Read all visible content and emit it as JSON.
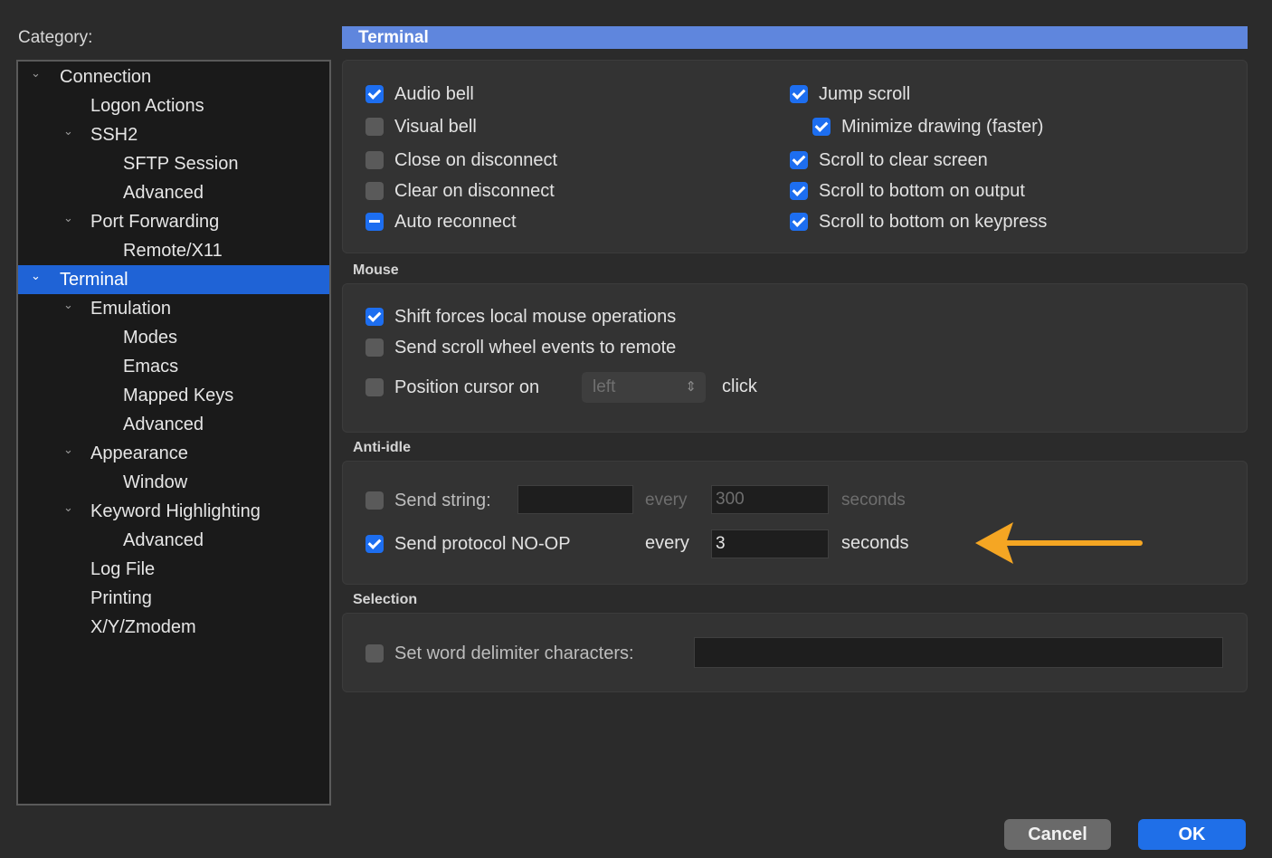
{
  "category_label": "Category:",
  "tree": [
    {
      "label": "Connection",
      "chevron": true,
      "level": 0
    },
    {
      "label": "Logon Actions",
      "chevron": false,
      "level": 1
    },
    {
      "label": "SSH2",
      "chevron": true,
      "level": 1
    },
    {
      "label": "SFTP Session",
      "chevron": false,
      "level": 2
    },
    {
      "label": "Advanced",
      "chevron": false,
      "level": 2
    },
    {
      "label": "Port Forwarding",
      "chevron": true,
      "level": 1
    },
    {
      "label": "Remote/X11",
      "chevron": false,
      "level": 2
    },
    {
      "label": "Terminal",
      "chevron": true,
      "level": 0,
      "selected": true
    },
    {
      "label": "Emulation",
      "chevron": true,
      "level": 1
    },
    {
      "label": "Modes",
      "chevron": false,
      "level": 2
    },
    {
      "label": "Emacs",
      "chevron": false,
      "level": 2
    },
    {
      "label": "Mapped Keys",
      "chevron": false,
      "level": 2
    },
    {
      "label": "Advanced",
      "chevron": false,
      "level": 2
    },
    {
      "label": "Appearance",
      "chevron": true,
      "level": 1
    },
    {
      "label": "Window",
      "chevron": false,
      "level": 2
    },
    {
      "label": "Keyword Highlighting",
      "chevron": true,
      "level": 1
    },
    {
      "label": "Advanced",
      "chevron": false,
      "level": 2
    },
    {
      "label": "Log File",
      "chevron": false,
      "level": 1
    },
    {
      "label": "Printing",
      "chevron": false,
      "level": 1
    },
    {
      "label": "X/Y/Zmodem",
      "chevron": false,
      "level": 1
    }
  ],
  "chevron_glyph": "⌄",
  "header_title": "Terminal",
  "general": {
    "audio_bell": {
      "label": "Audio bell",
      "state": "checked"
    },
    "visual_bell": {
      "label": "Visual bell",
      "state": "unchecked"
    },
    "close_on_disconnect": {
      "label": "Close on disconnect",
      "state": "unchecked"
    },
    "clear_on_disconnect": {
      "label": "Clear on disconnect",
      "state": "unchecked"
    },
    "auto_reconnect": {
      "label": "Auto reconnect",
      "state": "mixed"
    },
    "jump_scroll": {
      "label": "Jump scroll",
      "state": "checked"
    },
    "minimize_drawing": {
      "label": "Minimize drawing (faster)",
      "state": "checked"
    },
    "scroll_clear": {
      "label": "Scroll to clear screen",
      "state": "checked"
    },
    "scroll_output": {
      "label": "Scroll to bottom on output",
      "state": "checked"
    },
    "scroll_keypress": {
      "label": "Scroll to bottom on keypress",
      "state": "checked"
    }
  },
  "mouse": {
    "title": "Mouse",
    "shift_forces": {
      "label": "Shift forces local mouse operations",
      "state": "checked"
    },
    "send_scroll": {
      "label": "Send scroll wheel events to remote",
      "state": "unchecked"
    },
    "position_cursor": {
      "label": "Position cursor on",
      "state": "unchecked"
    },
    "position_select_value": "left",
    "select_arrows": "⇕",
    "click_label": "click"
  },
  "anti_idle": {
    "title": "Anti-idle",
    "send_string": {
      "label": "Send string:",
      "state": "unchecked"
    },
    "send_string_value": "",
    "every_label_1": "every",
    "interval_1": "300",
    "seconds_label_1": "seconds",
    "send_noop": {
      "label": "Send protocol NO-OP",
      "state": "checked"
    },
    "every_label_2": "every",
    "interval_2": "3",
    "seconds_label_2": "seconds"
  },
  "selection": {
    "title": "Selection",
    "word_delim": {
      "label": "Set word delimiter characters:",
      "state": "unchecked"
    },
    "word_delim_value": ""
  },
  "buttons": {
    "cancel": "Cancel",
    "ok": "OK"
  },
  "colors": {
    "selected": "#1f63d6",
    "header": "#5f86dd",
    "accent": "#1d6ef0",
    "arrow": "#f5a623"
  }
}
